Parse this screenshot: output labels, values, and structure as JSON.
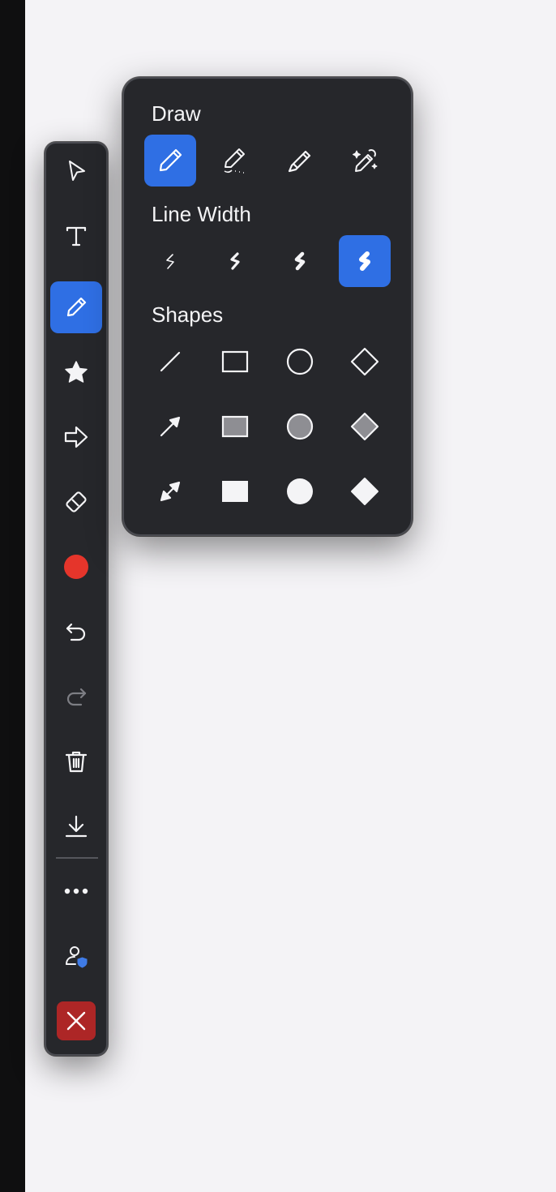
{
  "colors": {
    "toolbar_bg": "#26272b",
    "accent": "#2f6fe4",
    "record_red": "#e5352b",
    "close_red": "#ad2626",
    "icon": "#f4f4f6",
    "icon_disabled": "#7d7e84"
  },
  "toolbar": {
    "items": [
      {
        "name": "select",
        "icon": "pointer-arrow-icon",
        "active": false
      },
      {
        "name": "text",
        "icon": "text-icon",
        "active": false
      },
      {
        "name": "draw",
        "icon": "pencil-icon",
        "active": true
      },
      {
        "name": "stamp",
        "icon": "star-icon",
        "active": false
      },
      {
        "name": "spotlight",
        "icon": "arrow-right-outline-icon",
        "active": false
      },
      {
        "name": "eraser",
        "icon": "eraser-icon",
        "active": false
      },
      {
        "name": "color",
        "icon": "color-dot-icon",
        "active": false,
        "color": "#e5352b"
      },
      {
        "name": "undo",
        "icon": "undo-icon",
        "active": false
      },
      {
        "name": "redo",
        "icon": "redo-icon",
        "active": false,
        "disabled": true
      },
      {
        "name": "clear",
        "icon": "trash-icon",
        "active": false
      },
      {
        "name": "save",
        "icon": "download-icon",
        "active": false
      },
      {
        "name": "more",
        "icon": "more-icon",
        "active": false
      },
      {
        "name": "participants",
        "icon": "user-shield-icon",
        "active": false
      },
      {
        "name": "close",
        "icon": "close-icon",
        "active": false
      }
    ]
  },
  "panel": {
    "draw_title": "Draw",
    "draw_tools": [
      {
        "name": "pen",
        "icon": "pencil-icon",
        "active": true
      },
      {
        "name": "dotted-pen",
        "icon": "pencil-dotted-icon",
        "active": false
      },
      {
        "name": "highlighter",
        "icon": "highlighter-icon",
        "active": false
      },
      {
        "name": "magic-pen",
        "icon": "magic-pen-icon",
        "active": false
      }
    ],
    "line_width_title": "Line Width",
    "line_widths": [
      {
        "name": "width-1",
        "icon": "stroke-thin-icon",
        "active": false
      },
      {
        "name": "width-2",
        "icon": "stroke-medium-icon",
        "active": false
      },
      {
        "name": "width-3",
        "icon": "stroke-thick-icon",
        "active": false
      },
      {
        "name": "width-4",
        "icon": "stroke-heavy-icon",
        "active": true
      }
    ],
    "shapes_title": "Shapes",
    "shapes": [
      {
        "name": "line",
        "icon": "line-icon"
      },
      {
        "name": "rectangle-outline",
        "icon": "rectangle-outline-icon"
      },
      {
        "name": "circle-outline",
        "icon": "circle-outline-icon"
      },
      {
        "name": "diamond-outline",
        "icon": "diamond-outline-icon"
      },
      {
        "name": "arrow",
        "icon": "arrow-icon"
      },
      {
        "name": "rectangle-semi",
        "icon": "rectangle-semi-fill-icon"
      },
      {
        "name": "circle-semi",
        "icon": "circle-semi-fill-icon"
      },
      {
        "name": "diamond-semi",
        "icon": "diamond-semi-fill-icon"
      },
      {
        "name": "double-arrow",
        "icon": "double-arrow-icon"
      },
      {
        "name": "rectangle-filled",
        "icon": "rectangle-filled-icon"
      },
      {
        "name": "circle-filled",
        "icon": "circle-filled-icon"
      },
      {
        "name": "diamond-filled",
        "icon": "diamond-filled-icon"
      }
    ]
  }
}
